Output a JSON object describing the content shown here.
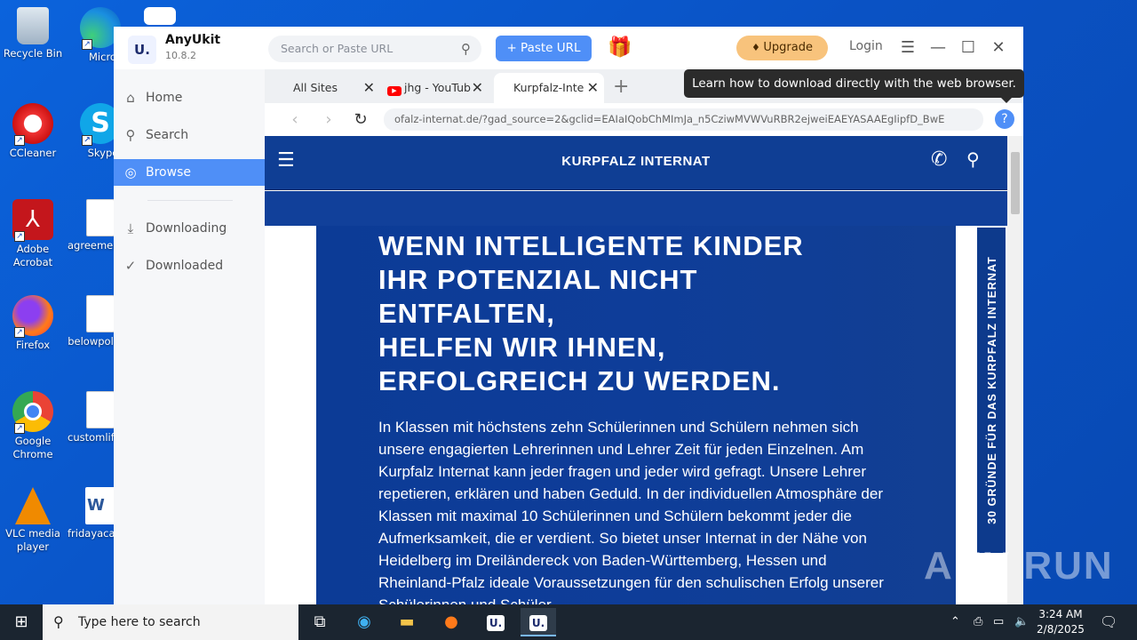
{
  "desktop": {
    "icons": [
      {
        "label": "Recycle Bin",
        "icon": "recycle-bin-icon"
      },
      {
        "label": "Microsoft Edge",
        "icon": "edge-icon"
      },
      {
        "label": "CCleaner",
        "icon": "ccleaner-icon"
      },
      {
        "label": "Skype",
        "icon": "skype-icon"
      },
      {
        "label": "Adobe Acrobat",
        "icon": "acrobat-icon"
      },
      {
        "label": "agreemen",
        "icon": "image-file-icon"
      },
      {
        "label": "Firefox",
        "icon": "firefox-icon"
      },
      {
        "label": "belowpol",
        "icon": "image-file-icon"
      },
      {
        "label": "Google Chrome",
        "icon": "chrome-icon"
      },
      {
        "label": "customlif",
        "icon": "image-file-icon"
      },
      {
        "label": "VLC media player",
        "icon": "vlc-icon"
      },
      {
        "label": "fridayaca",
        "icon": "word-file-icon"
      }
    ]
  },
  "app": {
    "name": "AnyUkit",
    "version": "10.8.2",
    "logo_text": "U.",
    "search_placeholder": "Search or Paste URL",
    "paste_url_label": "+ Paste URL",
    "upgrade_label": "Upgrade",
    "login_label": "Login",
    "accent_color": "#4f8ff7",
    "sidebar": {
      "items": [
        {
          "label": "Home",
          "icon": "home-icon"
        },
        {
          "label": "Search",
          "icon": "search-icon"
        },
        {
          "label": "Browse",
          "icon": "compass-icon",
          "active": true
        },
        {
          "label": "Downloading",
          "icon": "download-icon"
        },
        {
          "label": "Downloaded",
          "icon": "check-circle-icon"
        }
      ]
    },
    "browser": {
      "tabs": [
        {
          "label": "All Sites"
        },
        {
          "label": "jhg - YouTub"
        },
        {
          "label": "Kurpfalz-Inte",
          "active": true
        }
      ],
      "url": "ofalz-internat.de/?gad_source=2&gclid=EAIaIQobChMImJa_n5CziwMVWVuRBR2ejweiEAEYASAAEgIipfD_BwE",
      "tooltip": "Learn how to download directly with the web browser.",
      "page": {
        "site_title": "KURPFALZ INTERNAT",
        "headline_lines": [
          "WENN INTELLIGENTE KINDER",
          "IHR POTENZIAL NICHT",
          "ENTFALTEN,",
          "HELFEN WIR IHNEN,",
          "ERFOLGREICH ZU WERDEN."
        ],
        "body": "In Klassen mit höchstens zehn Schülerinnen und Schülern nehmen sich unsere engagierten Lehrerinnen und Lehrer Zeit für jeden Einzelnen. Am Kurpfalz Internat kann jeder fragen und jeder wird gefragt. Unsere Lehrer repetieren, erklären und haben Geduld. In der individuellen Atmosphäre der Klassen mit maximal 10 Schülerinnen und Schülern bekommt jeder die Aufmerksamkeit, die er verdient. So bietet unser Internat in der Nähe von Heidelberg im Dreiländereck von Baden-Württemberg, Hessen und Rheinland-Pfalz ideale Voraussetzungen für den schulischen Erfolg unserer Schülerinnen und Schüler.",
        "side_tab": "30 GRÜNDE FÜR DAS KURPFALZ INTERNAT",
        "brand_color": "#0f3e94"
      }
    }
  },
  "watermark": "ANY RUN",
  "taskbar": {
    "search_placeholder": "Type here to search",
    "time": "3:24 AM",
    "date": "2/8/2025"
  }
}
